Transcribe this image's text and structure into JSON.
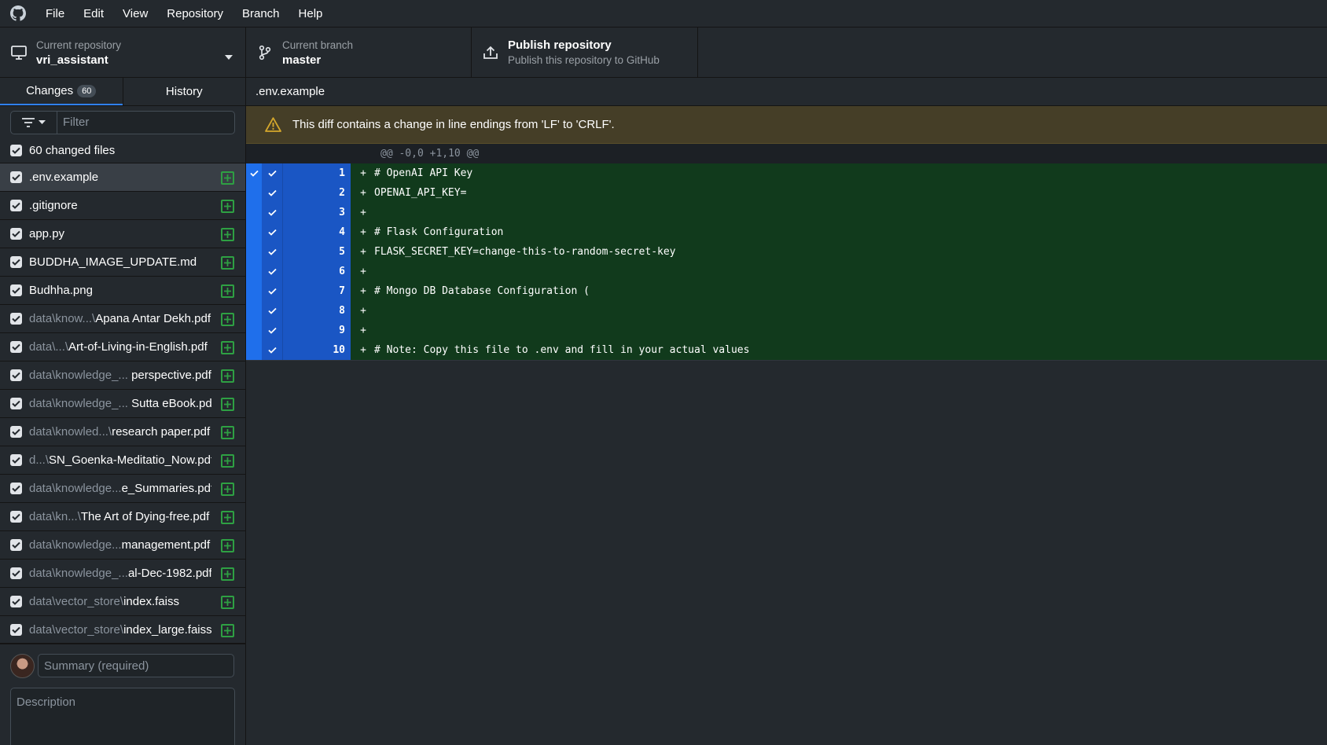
{
  "menu": {
    "logo_icon": "github-icon",
    "items": [
      "File",
      "Edit",
      "View",
      "Repository",
      "Branch",
      "Help"
    ]
  },
  "toolbar": {
    "repo_label": "Current repository",
    "repo_value": "vri_assistant",
    "branch_label": "Current branch",
    "branch_value": "master",
    "publish_title": "Publish repository",
    "publish_sub": "Publish this repository to GitHub"
  },
  "sidebar": {
    "tab_changes": "Changes",
    "tab_changes_count": "60",
    "tab_history": "History",
    "filter_placeholder": "Filter",
    "all_label": "60 changed files",
    "files": [
      {
        "dir": "",
        "base": ".env.example",
        "selected": true
      },
      {
        "dir": "",
        "base": ".gitignore"
      },
      {
        "dir": "",
        "base": "app.py"
      },
      {
        "dir": "",
        "base": "BUDDHA_IMAGE_UPDATE.md"
      },
      {
        "dir": "",
        "base": "Budhha.png"
      },
      {
        "dir": "data\\know...\\",
        "base": "Apana Antar Dekh.pdf"
      },
      {
        "dir": "data\\...\\",
        "base": "Art-of-Living-in-English.pdf"
      },
      {
        "dir": "data\\knowledge_... ",
        "base": "perspective.pdf"
      },
      {
        "dir": "data\\knowledge_... ",
        "base": "Sutta eBook.pdf"
      },
      {
        "dir": "data\\knowled...\\",
        "base": "research paper.pdf"
      },
      {
        "dir": "d...\\",
        "base": "SN_Goenka-Meditatio_Now.pdf"
      },
      {
        "dir": "data\\knowledge...",
        "base": "e_Summaries.pdf"
      },
      {
        "dir": "data\\kn...\\",
        "base": "The Art of Dying-free.pdf"
      },
      {
        "dir": "data\\knowledge...",
        "base": "management.pdf"
      },
      {
        "dir": "data\\knowledge_...",
        "base": "al-Dec-1982.pdf"
      },
      {
        "dir": "data\\vector_store\\",
        "base": "index.faiss"
      },
      {
        "dir": "data\\vector_store\\",
        "base": "index_large.faiss"
      }
    ],
    "summary_placeholder": "Summary (required)",
    "description_placeholder": "Description"
  },
  "diff": {
    "file_name": ".env.example",
    "warning": "This diff contains a change in line endings from 'LF' to 'CRLF'.",
    "hunk": "@@ -0,0 +1,10 @@",
    "lines": [
      {
        "num": "1",
        "code": "# OpenAI API Key"
      },
      {
        "num": "2",
        "code": "OPENAI_API_KEY="
      },
      {
        "num": "3",
        "code": ""
      },
      {
        "num": "4",
        "code": "# Flask Configuration"
      },
      {
        "num": "5",
        "code": "FLASK_SECRET_KEY=change-this-to-random-secret-key"
      },
      {
        "num": "6",
        "code": ""
      },
      {
        "num": "7",
        "code": "# Mongo DB Database Configuration ("
      },
      {
        "num": "8",
        "code": ""
      },
      {
        "num": "9",
        "code": ""
      },
      {
        "num": "10",
        "code": "# Note: Copy this file to .env and fill in your actual values"
      }
    ]
  },
  "colors": {
    "accent": "#2f81f7",
    "added_bg": "#113a1c",
    "added_icon": "#2ea043",
    "warning_bg": "#453e27",
    "warning_icon": "#d4a72c"
  }
}
